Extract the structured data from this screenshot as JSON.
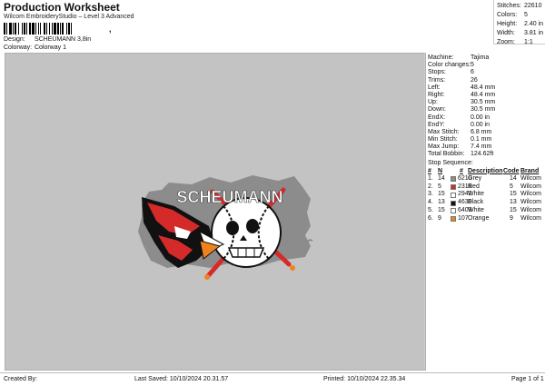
{
  "header": {
    "title": "Production Worksheet",
    "subtitle": "Wilcom EmbroideryStudio – Level 3 Advanced",
    "barcode_suffix": ","
  },
  "info": {
    "design_label": "Design:",
    "design_value": "SCHEUMANN 3,8in",
    "colorway_label": "Colorway:",
    "colorway_value": "Colorway 1"
  },
  "summary": [
    {
      "label": "Stitches:",
      "value": "22610"
    },
    {
      "label": "Colors:",
      "value": "5"
    },
    {
      "label": "Height:",
      "value": "2.40 in"
    },
    {
      "label": "Width:",
      "value": "3.81 in"
    },
    {
      "label": "Zoom:",
      "value": "1:1"
    }
  ],
  "machine_info": [
    {
      "label": "Machine:",
      "value": "Tajima"
    },
    {
      "label": "Color changes:",
      "value": "5"
    },
    {
      "label": "Stops:",
      "value": "6"
    },
    {
      "label": "Trims:",
      "value": "26"
    },
    {
      "label": "Left:",
      "value": "48.4 mm"
    },
    {
      "label": "Right:",
      "value": "48.4 mm"
    },
    {
      "label": "Up:",
      "value": "30.5 mm"
    },
    {
      "label": "Down:",
      "value": "30.5 mm"
    },
    {
      "label": "EndX:",
      "value": "0.00 in"
    },
    {
      "label": "EndY:",
      "value": "0.00 in"
    },
    {
      "label": "Max Stitch:",
      "value": "6.8 mm"
    },
    {
      "label": "Min Stitch:",
      "value": "0.1 mm"
    },
    {
      "label": "Max Jump:",
      "value": "7.4 mm"
    },
    {
      "label": "Total Bobbin:",
      "value": "124.62ft"
    }
  ],
  "stop_sequence": {
    "title": "Stop Sequence:",
    "headers": {
      "num": "#",
      "n": "N",
      "st": "#",
      "desc": "Description",
      "code": "Code",
      "brand": "Brand"
    },
    "rows": [
      {
        "num": "1.",
        "n": "14",
        "color": "#8c8c8c",
        "st": "6210",
        "desc": "Grey",
        "code": "14",
        "brand": "Wilcom"
      },
      {
        "num": "2.",
        "n": "5",
        "color": "#d42a2a",
        "st": "2316",
        "desc": "Red",
        "code": "5",
        "brand": "Wilcom"
      },
      {
        "num": "3.",
        "n": "15",
        "color": "#ffffff",
        "st": "2942",
        "desc": "White",
        "code": "15",
        "brand": "Wilcom"
      },
      {
        "num": "4.",
        "n": "13",
        "color": "#111111",
        "st": "4630",
        "desc": "Black",
        "code": "13",
        "brand": "Wilcom"
      },
      {
        "num": "5.",
        "n": "15",
        "color": "#ffffff",
        "st": "6403",
        "desc": "White",
        "code": "15",
        "brand": "Wilcom"
      },
      {
        "num": "6.",
        "n": "9",
        "color": "#f0821e",
        "st": "107",
        "desc": "Orange",
        "code": "9",
        "brand": "Wilcom"
      }
    ]
  },
  "design": {
    "text": "SCHEUMANN",
    "colors": {
      "grey": "#8c8c8c",
      "red": "#d42a2a",
      "black": "#111111",
      "white": "#ffffff",
      "orange": "#f0821e",
      "background": "#c3c3c3"
    }
  },
  "footer": {
    "created_by": "Created By:",
    "last_saved": "Last Saved: 10/10/2024 20.31.57",
    "printed": "Printed: 10/10/2024 22.35.34",
    "page": "Page 1 of 1"
  }
}
